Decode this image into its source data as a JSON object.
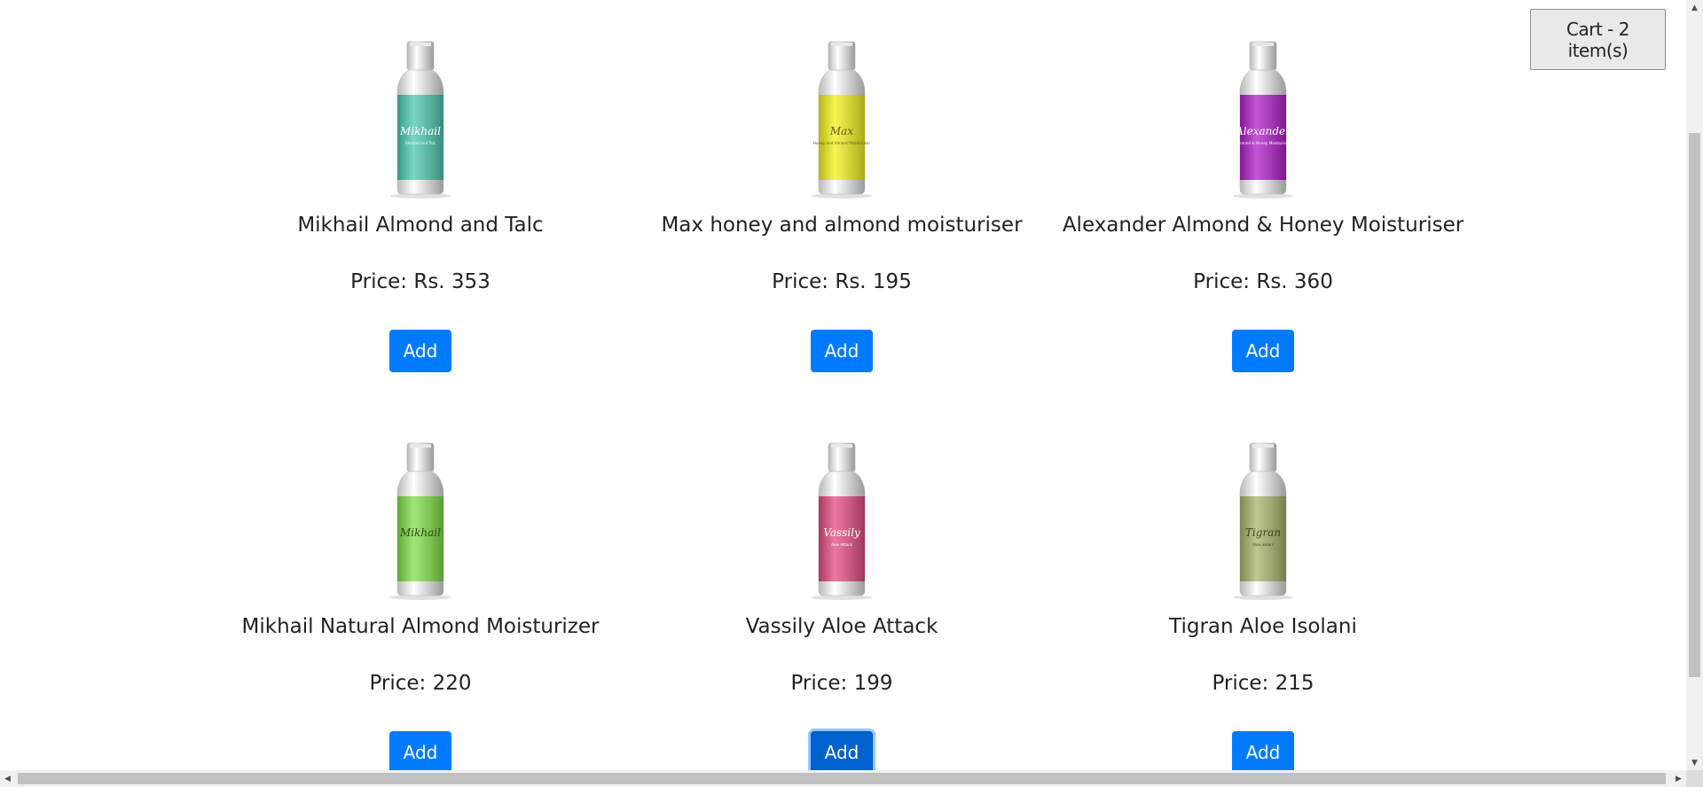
{
  "cart": {
    "label": "Cart - 2 item(s)"
  },
  "products": [
    {
      "name": "Mikhail Almond and Talc",
      "price": "Price: Rs. 353",
      "add_label": "Add",
      "bottle": {
        "color": "#4dc9b0",
        "brand": "Mikhail",
        "sub": "Almond and Talc",
        "text_color": "#ffffff"
      }
    },
    {
      "name": "Max honey and almond moisturiser",
      "price": "Price: Rs. 195",
      "add_label": "Add",
      "bottle": {
        "color": "#f2f21e",
        "brand": "Max",
        "sub": "Honey and Almond Moisturiser",
        "text_color": "#6b5a12"
      }
    },
    {
      "name": "Alexander Almond & Honey Moisturiser",
      "price": "Price: Rs. 360",
      "add_label": "Add",
      "bottle": {
        "color": "#b01fc9",
        "brand": "Alexander",
        "sub": "Almond & Honey Moisturiser",
        "text_color": "#ffffff"
      }
    },
    {
      "name": "Mikhail Natural Almond Moisturizer",
      "price": "Price: 220",
      "add_label": "Add",
      "bottle": {
        "color": "#7fe04a",
        "brand": "Mikhail",
        "sub": "",
        "text_color": "#2b4a12"
      }
    },
    {
      "name": "Vassily Aloe Attack",
      "price": "Price: 199",
      "add_label": "Add",
      "bottle": {
        "color": "#e54c82",
        "brand": "Vassily",
        "sub": "Aloe Attack",
        "text_color": "#ffffff"
      }
    },
    {
      "name": "Tigran Aloe Isolani",
      "price": "Price: 215",
      "add_label": "Add",
      "bottle": {
        "color": "#a9b56c",
        "brand": "Tigran",
        "sub": "Aloe Isolani",
        "text_color": "#3d4223"
      }
    }
  ],
  "focused_add_index": 4,
  "colors": {
    "primary": "#007bff",
    "primary_focused": "#0062cc"
  },
  "scrollbars": {
    "vertical": {
      "icon_up": "scroll-up-arrow-icon",
      "icon_down": "scroll-down-arrow-icon"
    },
    "horizontal": {
      "icon_left": "scroll-left-arrow-icon",
      "icon_right": "scroll-right-arrow-icon"
    }
  }
}
